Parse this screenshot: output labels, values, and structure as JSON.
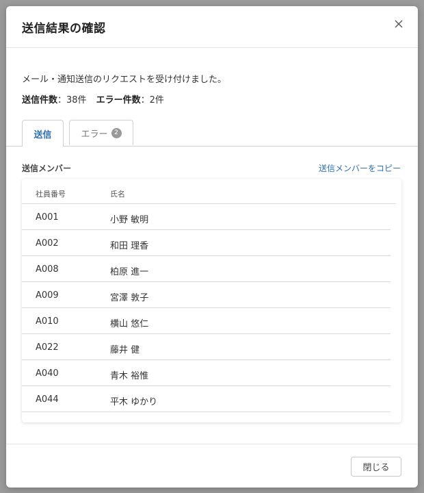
{
  "modal": {
    "title": "送信結果の確認",
    "message": "メール・通知送信のリクエストを受け付けました。",
    "counts": {
      "sent_label": "送信件数",
      "sent_value": "：38件",
      "error_label": "エラー件数",
      "error_value": "：2件"
    },
    "tabs": [
      {
        "label": "送信",
        "active": true
      },
      {
        "label": "エラー",
        "badge": "2",
        "active": false
      }
    ],
    "section_label": "送信メンバー",
    "copy_link": "送信メンバーをコピー",
    "table": {
      "headers": [
        "社員番号",
        "氏名"
      ],
      "rows": [
        {
          "id": "A001",
          "name": "小野 敏明"
        },
        {
          "id": "A002",
          "name": "和田 理香"
        },
        {
          "id": "A008",
          "name": "柏原 進一"
        },
        {
          "id": "A009",
          "name": "宮澤 敦子"
        },
        {
          "id": "A010",
          "name": "横山 悠仁"
        },
        {
          "id": "A022",
          "name": "藤井 健"
        },
        {
          "id": "A040",
          "name": "青木 裕惟"
        },
        {
          "id": "A044",
          "name": "平木 ゆかり"
        }
      ]
    },
    "footer": {
      "close_label": "閉じる"
    }
  },
  "colors": {
    "accent": "#2f6fb3",
    "badge": "#999999"
  }
}
